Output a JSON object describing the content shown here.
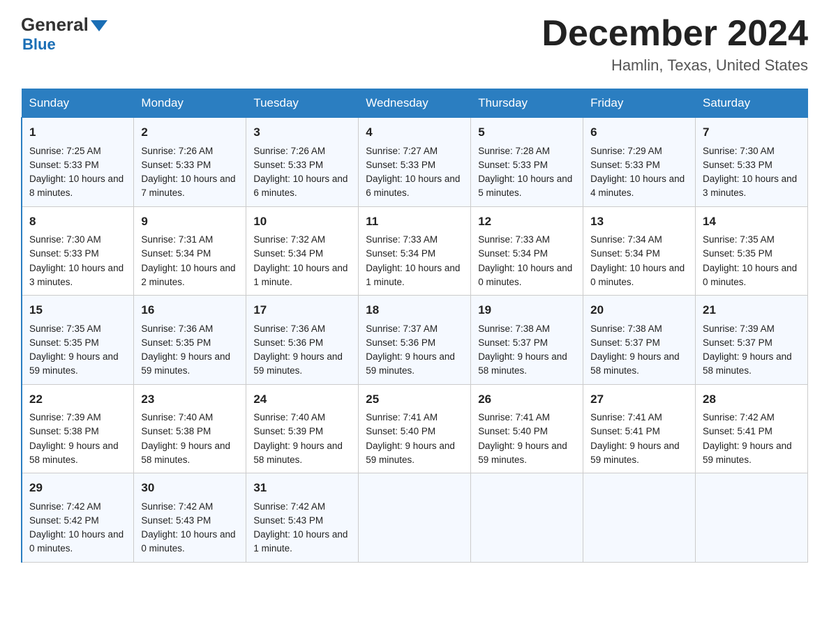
{
  "logo": {
    "general": "General",
    "blue": "Blue"
  },
  "header": {
    "month": "December 2024",
    "location": "Hamlin, Texas, United States"
  },
  "weekdays": [
    "Sunday",
    "Monday",
    "Tuesday",
    "Wednesday",
    "Thursday",
    "Friday",
    "Saturday"
  ],
  "weeks": [
    [
      {
        "day": "1",
        "sunrise": "7:25 AM",
        "sunset": "5:33 PM",
        "daylight": "10 hours and 8 minutes."
      },
      {
        "day": "2",
        "sunrise": "7:26 AM",
        "sunset": "5:33 PM",
        "daylight": "10 hours and 7 minutes."
      },
      {
        "day": "3",
        "sunrise": "7:26 AM",
        "sunset": "5:33 PM",
        "daylight": "10 hours and 6 minutes."
      },
      {
        "day": "4",
        "sunrise": "7:27 AM",
        "sunset": "5:33 PM",
        "daylight": "10 hours and 6 minutes."
      },
      {
        "day": "5",
        "sunrise": "7:28 AM",
        "sunset": "5:33 PM",
        "daylight": "10 hours and 5 minutes."
      },
      {
        "day": "6",
        "sunrise": "7:29 AM",
        "sunset": "5:33 PM",
        "daylight": "10 hours and 4 minutes."
      },
      {
        "day": "7",
        "sunrise": "7:30 AM",
        "sunset": "5:33 PM",
        "daylight": "10 hours and 3 minutes."
      }
    ],
    [
      {
        "day": "8",
        "sunrise": "7:30 AM",
        "sunset": "5:33 PM",
        "daylight": "10 hours and 3 minutes."
      },
      {
        "day": "9",
        "sunrise": "7:31 AM",
        "sunset": "5:34 PM",
        "daylight": "10 hours and 2 minutes."
      },
      {
        "day": "10",
        "sunrise": "7:32 AM",
        "sunset": "5:34 PM",
        "daylight": "10 hours and 1 minute."
      },
      {
        "day": "11",
        "sunrise": "7:33 AM",
        "sunset": "5:34 PM",
        "daylight": "10 hours and 1 minute."
      },
      {
        "day": "12",
        "sunrise": "7:33 AM",
        "sunset": "5:34 PM",
        "daylight": "10 hours and 0 minutes."
      },
      {
        "day": "13",
        "sunrise": "7:34 AM",
        "sunset": "5:34 PM",
        "daylight": "10 hours and 0 minutes."
      },
      {
        "day": "14",
        "sunrise": "7:35 AM",
        "sunset": "5:35 PM",
        "daylight": "10 hours and 0 minutes."
      }
    ],
    [
      {
        "day": "15",
        "sunrise": "7:35 AM",
        "sunset": "5:35 PM",
        "daylight": "9 hours and 59 minutes."
      },
      {
        "day": "16",
        "sunrise": "7:36 AM",
        "sunset": "5:35 PM",
        "daylight": "9 hours and 59 minutes."
      },
      {
        "day": "17",
        "sunrise": "7:36 AM",
        "sunset": "5:36 PM",
        "daylight": "9 hours and 59 minutes."
      },
      {
        "day": "18",
        "sunrise": "7:37 AM",
        "sunset": "5:36 PM",
        "daylight": "9 hours and 59 minutes."
      },
      {
        "day": "19",
        "sunrise": "7:38 AM",
        "sunset": "5:37 PM",
        "daylight": "9 hours and 58 minutes."
      },
      {
        "day": "20",
        "sunrise": "7:38 AM",
        "sunset": "5:37 PM",
        "daylight": "9 hours and 58 minutes."
      },
      {
        "day": "21",
        "sunrise": "7:39 AM",
        "sunset": "5:37 PM",
        "daylight": "9 hours and 58 minutes."
      }
    ],
    [
      {
        "day": "22",
        "sunrise": "7:39 AM",
        "sunset": "5:38 PM",
        "daylight": "9 hours and 58 minutes."
      },
      {
        "day": "23",
        "sunrise": "7:40 AM",
        "sunset": "5:38 PM",
        "daylight": "9 hours and 58 minutes."
      },
      {
        "day": "24",
        "sunrise": "7:40 AM",
        "sunset": "5:39 PM",
        "daylight": "9 hours and 58 minutes."
      },
      {
        "day": "25",
        "sunrise": "7:41 AM",
        "sunset": "5:40 PM",
        "daylight": "9 hours and 59 minutes."
      },
      {
        "day": "26",
        "sunrise": "7:41 AM",
        "sunset": "5:40 PM",
        "daylight": "9 hours and 59 minutes."
      },
      {
        "day": "27",
        "sunrise": "7:41 AM",
        "sunset": "5:41 PM",
        "daylight": "9 hours and 59 minutes."
      },
      {
        "day": "28",
        "sunrise": "7:42 AM",
        "sunset": "5:41 PM",
        "daylight": "9 hours and 59 minutes."
      }
    ],
    [
      {
        "day": "29",
        "sunrise": "7:42 AM",
        "sunset": "5:42 PM",
        "daylight": "10 hours and 0 minutes."
      },
      {
        "day": "30",
        "sunrise": "7:42 AM",
        "sunset": "5:43 PM",
        "daylight": "10 hours and 0 minutes."
      },
      {
        "day": "31",
        "sunrise": "7:42 AM",
        "sunset": "5:43 PM",
        "daylight": "10 hours and 1 minute."
      },
      null,
      null,
      null,
      null
    ]
  ],
  "labels": {
    "sunrise": "Sunrise:",
    "sunset": "Sunset:",
    "daylight": "Daylight:"
  }
}
